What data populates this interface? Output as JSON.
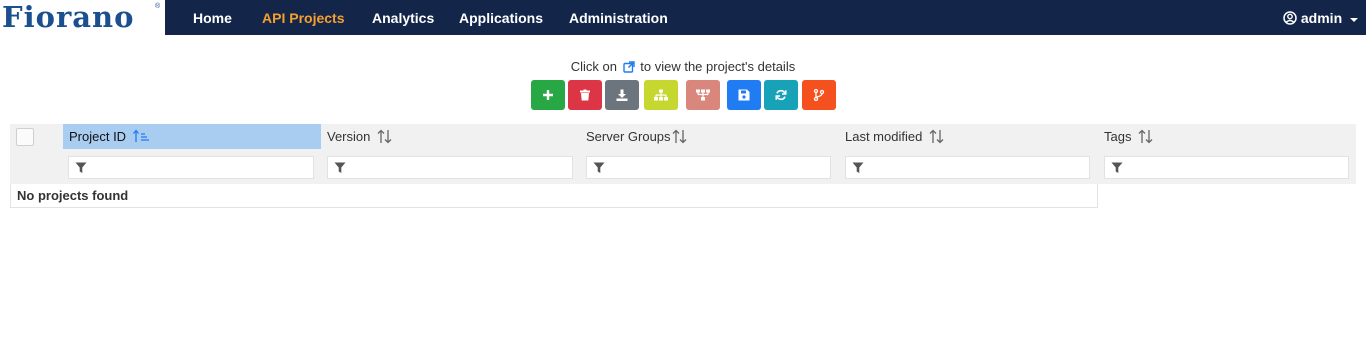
{
  "brand": {
    "logo_text": "Fiorano",
    "logo_mark": "®",
    "logo_color": "#1b4f8e"
  },
  "nav": {
    "items": [
      {
        "label": "Home",
        "active": false
      },
      {
        "label": "API Projects",
        "active": true
      },
      {
        "label": "Analytics",
        "active": false
      },
      {
        "label": "Applications",
        "active": false
      },
      {
        "label": "Administration",
        "active": false
      }
    ],
    "user": {
      "name": "admin",
      "icon": "user-circle-icon",
      "caret": "caret-down-icon"
    },
    "background": "#13264a",
    "active_color": "#f5a02c"
  },
  "hint": {
    "prefix": "Click on",
    "icon": "external-link-icon",
    "suffix": "to view the project's details"
  },
  "toolbar": {
    "buttons": [
      {
        "name": "add-project-button",
        "icon": "plus-icon",
        "color": "#28a745"
      },
      {
        "name": "delete-project-button",
        "icon": "trash-icon",
        "color": "#dc3545"
      },
      {
        "name": "import-project-button",
        "icon": "download-icon",
        "color": "#6c757d"
      },
      {
        "name": "hierarchy-button",
        "icon": "sitemap-icon",
        "color": "#c6d730"
      },
      {
        "name": "deploy-button",
        "icon": "network-icon",
        "color": "#d9877c"
      },
      {
        "name": "save-button",
        "icon": "save-icon",
        "color": "#1f7cf2"
      },
      {
        "name": "refresh-button",
        "icon": "refresh-icon",
        "color": "#17a2b8"
      },
      {
        "name": "git-branch-button",
        "icon": "git-branch-icon",
        "color": "#f4511e"
      }
    ]
  },
  "table": {
    "columns": [
      {
        "label": "Project ID",
        "sort": "ascending"
      },
      {
        "label": "Version",
        "sort": "none"
      },
      {
        "label": "Server Groups",
        "sort": "none"
      },
      {
        "label": "Last modified",
        "sort": "none"
      },
      {
        "label": "Tags",
        "sort": "none"
      }
    ],
    "filter_icon": "filter-icon",
    "empty_message": "No projects found"
  }
}
